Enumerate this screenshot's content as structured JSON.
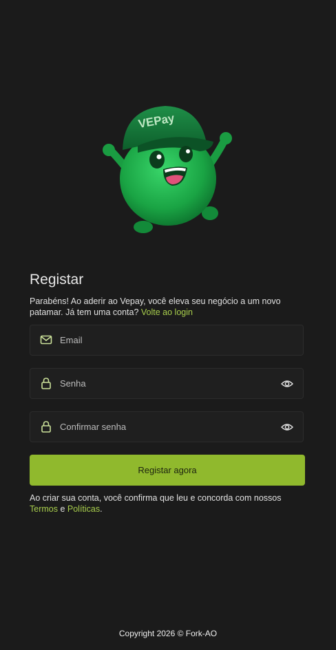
{
  "mascot": {
    "cap_text": "VEPay"
  },
  "register": {
    "title": "Registar",
    "intro": "Parabéns! Ao aderir ao Vepay, você eleva seu negócio a um novo patamar. Já tem uma conta? ",
    "login_link": "Volte ao login"
  },
  "form": {
    "email_placeholder": "Email",
    "password_placeholder": "Senha",
    "confirm_placeholder": "Confirmar senha",
    "submit_label": "Registar agora"
  },
  "terms": {
    "prefix": "Ao criar sua conta, você confirma que leu e concorda com nossos ",
    "terms_link": "Termos",
    "conjunction": " e ",
    "policies_link": "Políticas",
    "suffix": "."
  },
  "footer": {
    "copyright": "Copyright 2026 © Fork-AO"
  },
  "colors": {
    "background": "#1b1b1b",
    "accent": "#90b92d",
    "link": "#a9cf4d",
    "icon": "#cde39b",
    "mascot_green": "#1fae4a"
  }
}
